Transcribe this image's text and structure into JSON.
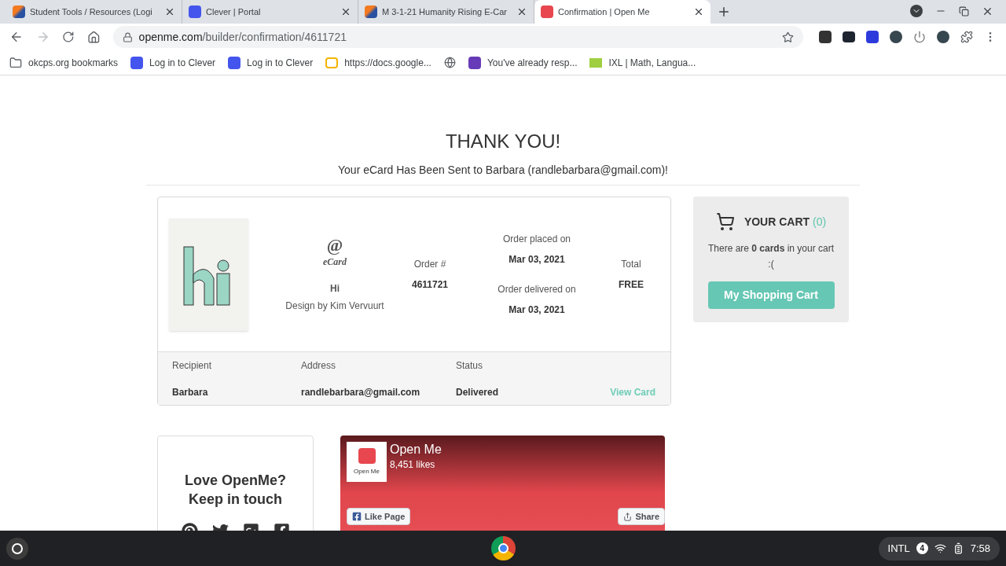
{
  "browser": {
    "tabs": [
      {
        "title": "Student Tools / Resources (Logi",
        "selected": false
      },
      {
        "title": "Clever | Portal",
        "selected": false
      },
      {
        "title": "M 3-1-21 Humanity Rising E-Car",
        "selected": false
      },
      {
        "title": "Confirmation | Open Me",
        "selected": true
      }
    ],
    "address": {
      "host": "openme.com",
      "path": "/builder/confirmation/4611721"
    },
    "bookmarks": [
      "okcps.org bookmarks",
      "Log in to Clever",
      "Log in to Clever",
      "https://docs.google...",
      "You've already resp...",
      "IXL | Math, Langua..."
    ]
  },
  "page": {
    "heading": "THANK YOU!",
    "subheading": "Your eCard Has Been Sent to Barbara (randlebarbara@gmail.com)!",
    "order": {
      "symbol": "@",
      "card_type": "eCard",
      "card_name": "Hi",
      "designer": "Design by Kim Vervuurt",
      "order_number_label": "Order #",
      "order_number": "4611721",
      "placed_label": "Order placed on",
      "placed_date": "Mar 03, 2021",
      "delivered_label": "Order delivered on",
      "delivered_date": "Mar 03, 2021",
      "total_label": "Total",
      "total": "FREE"
    },
    "details": {
      "columns": [
        "Recipient",
        "Address",
        "Status"
      ],
      "values": [
        "Barbara",
        "randlebarbara@gmail.com",
        "Delivered"
      ],
      "link": "View Card"
    },
    "cart": {
      "title": "YOUR CART",
      "count": "(0)",
      "message": "There are **0 cards** in your cart",
      "face": ":(",
      "button": "My Shopping Cart"
    },
    "social": {
      "heading": [
        "Love OpenMe?",
        "Keep in touch"
      ]
    },
    "facebook": {
      "logo_text": "Open Me",
      "page_name": "Open Me",
      "likes": "8,451 likes",
      "like_button": "Like Page",
      "share_button": "Share"
    }
  },
  "shelf": {
    "input_method": "INTL",
    "notifications": "4",
    "time": "7:58"
  }
}
